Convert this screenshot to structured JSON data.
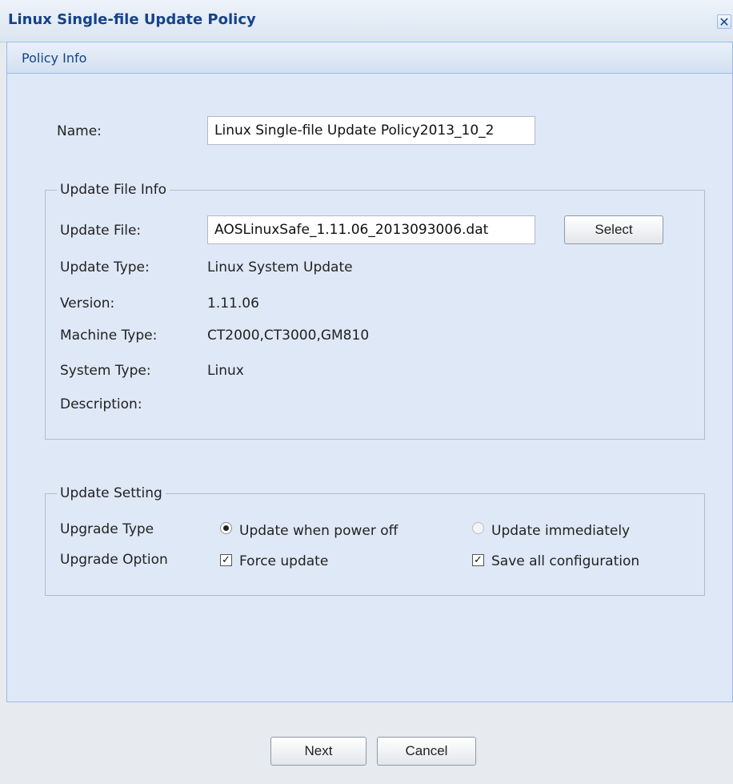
{
  "window": {
    "title": "Linux Single-file Update Policy",
    "close_glyph": "✕"
  },
  "panel": {
    "title": "Policy Info"
  },
  "name_field": {
    "label": "Name:",
    "value": "Linux Single-file Update Policy2013_10_2"
  },
  "update_file_info": {
    "legend": "Update File Info",
    "update_file": {
      "label": "Update File:",
      "value": "AOSLinuxSafe_1.11.06_2013093006.dat"
    },
    "select_button": "Select",
    "update_type": {
      "label": "Update Type:",
      "value": "Linux System Update"
    },
    "version": {
      "label": "Version:",
      "value": "1.11.06"
    },
    "machine_type": {
      "label": "Machine Type:",
      "value": "CT2000,CT3000,GM810"
    },
    "system_type": {
      "label": "System Type:",
      "value": "Linux"
    },
    "description": {
      "label": "Description:",
      "value": ""
    }
  },
  "update_setting": {
    "legend": "Update Setting",
    "upgrade_type": {
      "label": "Upgrade Type",
      "options": [
        {
          "label": "Update when power off",
          "checked": true
        },
        {
          "label": "Update immediately",
          "checked": false
        }
      ]
    },
    "upgrade_option": {
      "label": "Upgrade Option",
      "options": [
        {
          "label": "Force update",
          "checked": true
        },
        {
          "label": "Save all configuration",
          "checked": true
        }
      ]
    }
  },
  "footer": {
    "next_label": "Next",
    "cancel_label": "Cancel"
  },
  "colors": {
    "title_text": "#15428b",
    "panel_bg": "#dfe8f6",
    "panel_border": "#99bbe8"
  },
  "icons": {
    "close": "close-icon",
    "radio": "radio-icon",
    "checkbox": "checkbox-icon"
  }
}
